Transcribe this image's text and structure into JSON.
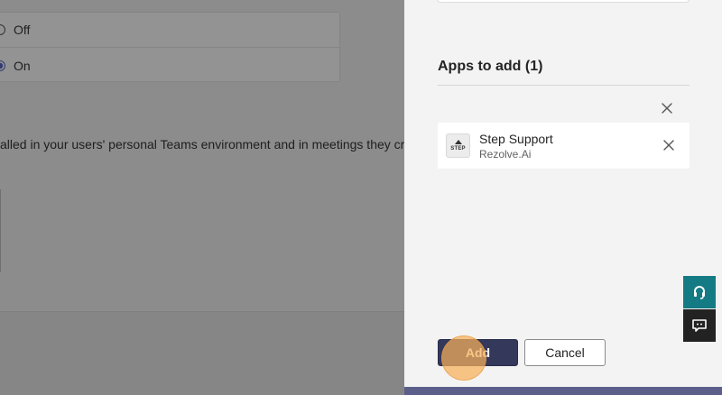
{
  "background": {
    "options": [
      {
        "label": "Off",
        "selected": false
      },
      {
        "label": "On",
        "selected": true
      }
    ],
    "description": "alled in your users' personal Teams environment and in meetings they create. U"
  },
  "panel": {
    "section_title": "Apps to add (1)",
    "apps": [
      {
        "name": "Step Support",
        "publisher": "Rezolve.Ai",
        "logo_text": "STEP",
        "logo_icon": "step-logo-icon"
      }
    ],
    "add_label": "Add",
    "cancel_label": "Cancel"
  },
  "widgets": {
    "help_icon": "headset-icon",
    "feedback_icon": "chat-feedback-icon"
  },
  "colors": {
    "accent": "#34385a",
    "panel_bar": "#5d5f8b",
    "help_widget": "#147b84",
    "feedback_widget": "#222222",
    "click_highlight": "#f6b05a"
  }
}
